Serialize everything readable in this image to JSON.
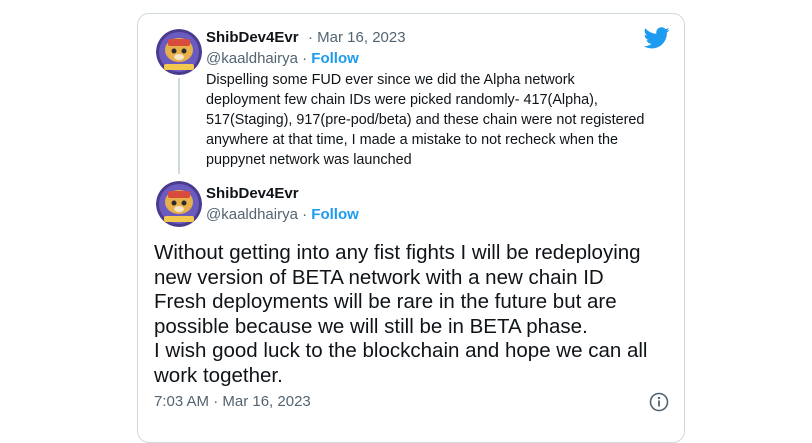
{
  "quoted_tweet": {
    "display_name": "ShibDev4Evr",
    "separator": "·",
    "date": "Mar 16, 2023",
    "handle": "@kaaldhairya",
    "follow_sep": "·",
    "follow_label": "Follow",
    "text_lines": [
      "Dispelling some FUD ever since we did the Alpha network",
      "deployment few chain IDs were picked randomly- 417(Alpha),",
      "517(Staging), 917(pre-pod/beta) and these chain were not registered",
      "anywhere at that time, I made a mistake to not recheck when the",
      "puppynet network was launched"
    ]
  },
  "main_tweet": {
    "display_name": "ShibDev4Evr",
    "handle": "@kaaldhairya",
    "follow_sep": "·",
    "follow_label": "Follow",
    "text_lines": [
      "Without getting into any fist fights I will be redeploying",
      "new version of BETA network with a new chain ID",
      "Fresh deployments will be rare in the future but are",
      "possible because we will still be in BETA phase.",
      "I wish good luck to the blockchain and hope we can all",
      "work together."
    ],
    "timestamp": "7:03 AM · Mar 16, 2023"
  },
  "icons": {
    "brand": "twitter-bird-icon",
    "info": "info-icon",
    "brand_color": "#1d9bf0"
  }
}
